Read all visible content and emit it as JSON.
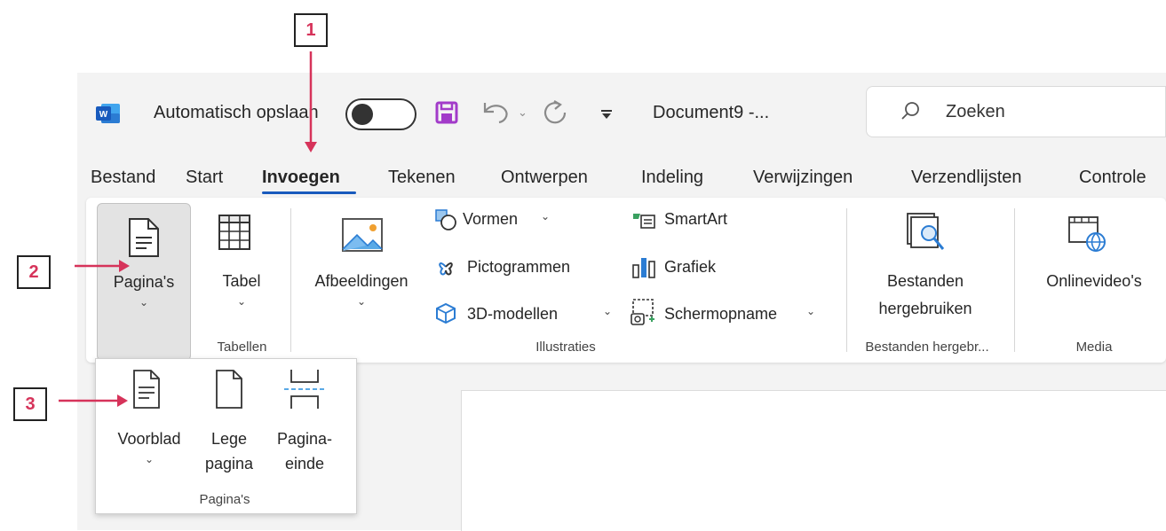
{
  "titlebar": {
    "autosave_label": "Automatisch opslaan",
    "document_name": "Document9 -...",
    "search_placeholder": "Zoeken"
  },
  "tabs": [
    {
      "label": "Bestand",
      "active": false
    },
    {
      "label": "Start",
      "active": false
    },
    {
      "label": "Invoegen",
      "active": true
    },
    {
      "label": "Tekenen",
      "active": false
    },
    {
      "label": "Ontwerpen",
      "active": false
    },
    {
      "label": "Indeling",
      "active": false
    },
    {
      "label": "Verwijzingen",
      "active": false
    },
    {
      "label": "Verzendlijsten",
      "active": false
    },
    {
      "label": "Controle",
      "active": false
    }
  ],
  "ribbon": {
    "paginas": "Pagina's",
    "tabel": "Tabel",
    "tabellen_group": "Tabellen",
    "afbeeldingen": "Afbeeldingen",
    "vormen": "Vormen",
    "pictogrammen": "Pictogrammen",
    "modellen_3d": "3D-modellen",
    "smartart": "SmartArt",
    "grafiek": "Grafiek",
    "schermopname": "Schermopname",
    "illustraties_group": "Illustraties",
    "bestanden_line1": "Bestanden",
    "bestanden_line2": "hergebruiken",
    "bestanden_group": "Bestanden hergebr...",
    "onlinevideo": "Onlinevideo's",
    "media_group": "Media"
  },
  "dropdown": {
    "voorblad": "Voorblad",
    "lege_line1": "Lege",
    "lege_line2": "pagina",
    "einde_line1": "Pagina-",
    "einde_line2": "einde",
    "group": "Pagina's"
  },
  "callouts": [
    "1",
    "2",
    "3"
  ],
  "colors": {
    "accent_arrow": "#d6335a",
    "word_blue": "#185abd",
    "save_purple": "#a23bc9",
    "active_underline": "#185abd"
  }
}
